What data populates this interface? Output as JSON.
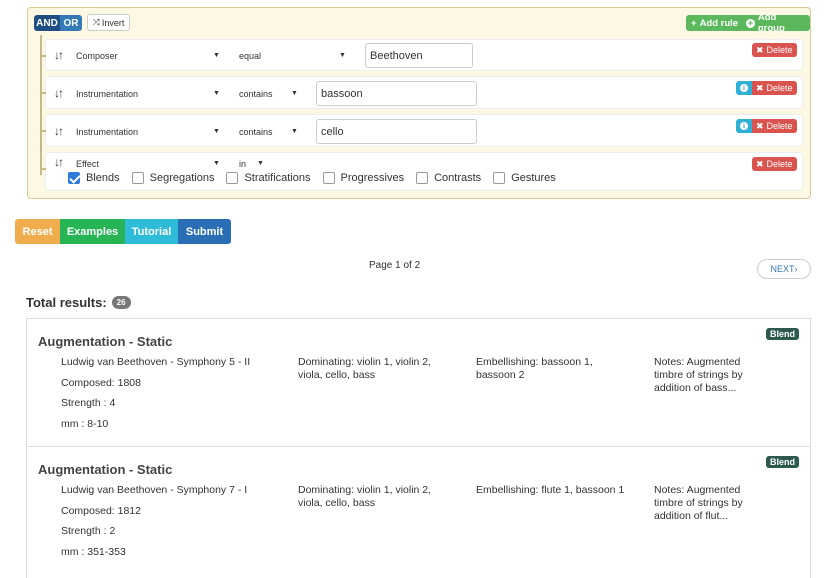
{
  "query_builder": {
    "and_label": "AND",
    "or_label": "OR",
    "invert_label": "Invert",
    "add_rule_label": "Add rule",
    "add_group_label": "Add group",
    "delete_label": "Delete",
    "rules": [
      {
        "field": "Composer",
        "operator": "equal",
        "value": "Beethoven"
      },
      {
        "field": "Instrumentation",
        "operator": "contains",
        "value": "bassoon"
      },
      {
        "field": "Instrumentation",
        "operator": "contains",
        "value": "cello"
      },
      {
        "field": "Effect",
        "operator": "in",
        "options": [
          {
            "label": "Blends",
            "checked": true
          },
          {
            "label": "Segregations",
            "checked": false
          },
          {
            "label": "Stratifications",
            "checked": false
          },
          {
            "label": "Progressives",
            "checked": false
          },
          {
            "label": "Contrasts",
            "checked": false
          },
          {
            "label": "Gestures",
            "checked": false
          }
        ]
      }
    ]
  },
  "actions": {
    "reset": "Reset",
    "examples": "Examples",
    "tutorial": "Tutorial",
    "submit": "Submit"
  },
  "pagination": {
    "page_info": "Page 1 of 2",
    "next_label": "NEXT"
  },
  "total": {
    "label": "Total results:",
    "count": "26"
  },
  "results": [
    {
      "title": "Augmentation - Static",
      "tag": "Blend",
      "work": "Ludwig van Beethoven - Symphony 5 - II",
      "composed": "Composed: 1808",
      "strength": "Strength : 4",
      "mm": "mm : 8-10",
      "dominating": "Dominating: violin 1, violin 2, viola, cello, bass",
      "embellishing": "Embellishing: bassoon 1, bassoon 2",
      "notes": "Notes: Augmented timbre of strings by addition of bass..."
    },
    {
      "title": "Augmentation - Static",
      "tag": "Blend",
      "work": "Ludwig van Beethoven - Symphony 7 - I",
      "composed": "Composed: 1812",
      "strength": "Strength : 2",
      "mm": "mm : 351-353",
      "dominating": "Dominating: violin 1, violin 2, viola, cello, bass",
      "embellishing": "Embellishing: flute 1, bassoon 1",
      "notes": "Notes: Augmented timbre of strings by addition of flut..."
    }
  ]
}
